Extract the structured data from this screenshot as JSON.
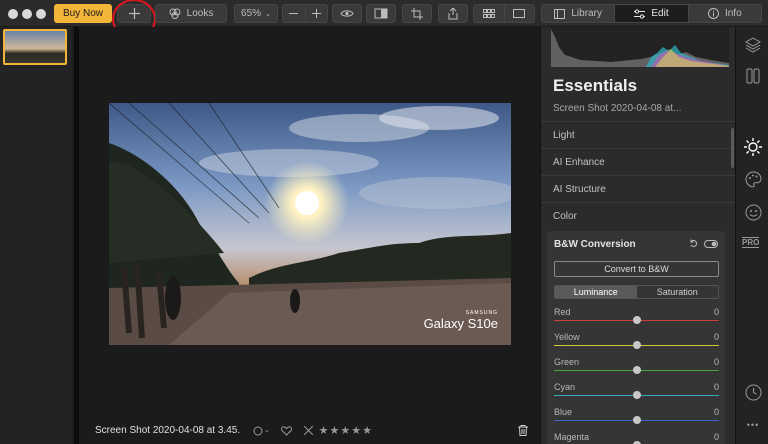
{
  "toolbar": {
    "buy_label": "Buy Now",
    "looks_label": "Looks",
    "zoom_label": "65%",
    "library_label": "Library",
    "edit_label": "Edit",
    "info_label": "Info"
  },
  "canvas": {
    "watermark_brand": "SAMSUNG",
    "watermark_model": "Galaxy S10e",
    "caption": "Screen Shot 2020-04-08 at 3.45.",
    "rating_dash": "-",
    "stars": "★★★★★"
  },
  "panel": {
    "title": "Essentials",
    "subtitle": "Screen Shot 2020-04-08 at...",
    "sections": [
      "Light",
      "AI Enhance",
      "AI Structure",
      "Color"
    ],
    "bw_title": "B&W Conversion",
    "convert_label": "Convert to B&W",
    "tab_luminance": "Luminance",
    "tab_saturation": "Saturation",
    "sliders": [
      {
        "label": "Red",
        "value": "0",
        "color": "#c9423c"
      },
      {
        "label": "Yellow",
        "value": "0",
        "color": "#d8c438"
      },
      {
        "label": "Green",
        "value": "0",
        "color": "#47a640"
      },
      {
        "label": "Cyan",
        "value": "0",
        "color": "#38a8c0"
      },
      {
        "label": "Blue",
        "value": "0",
        "color": "#3a68c8"
      },
      {
        "label": "Magenta",
        "value": "0",
        "color": "#b83ab8"
      }
    ]
  },
  "strip": {
    "pro_label": "PRO",
    "more_label": "•••"
  }
}
